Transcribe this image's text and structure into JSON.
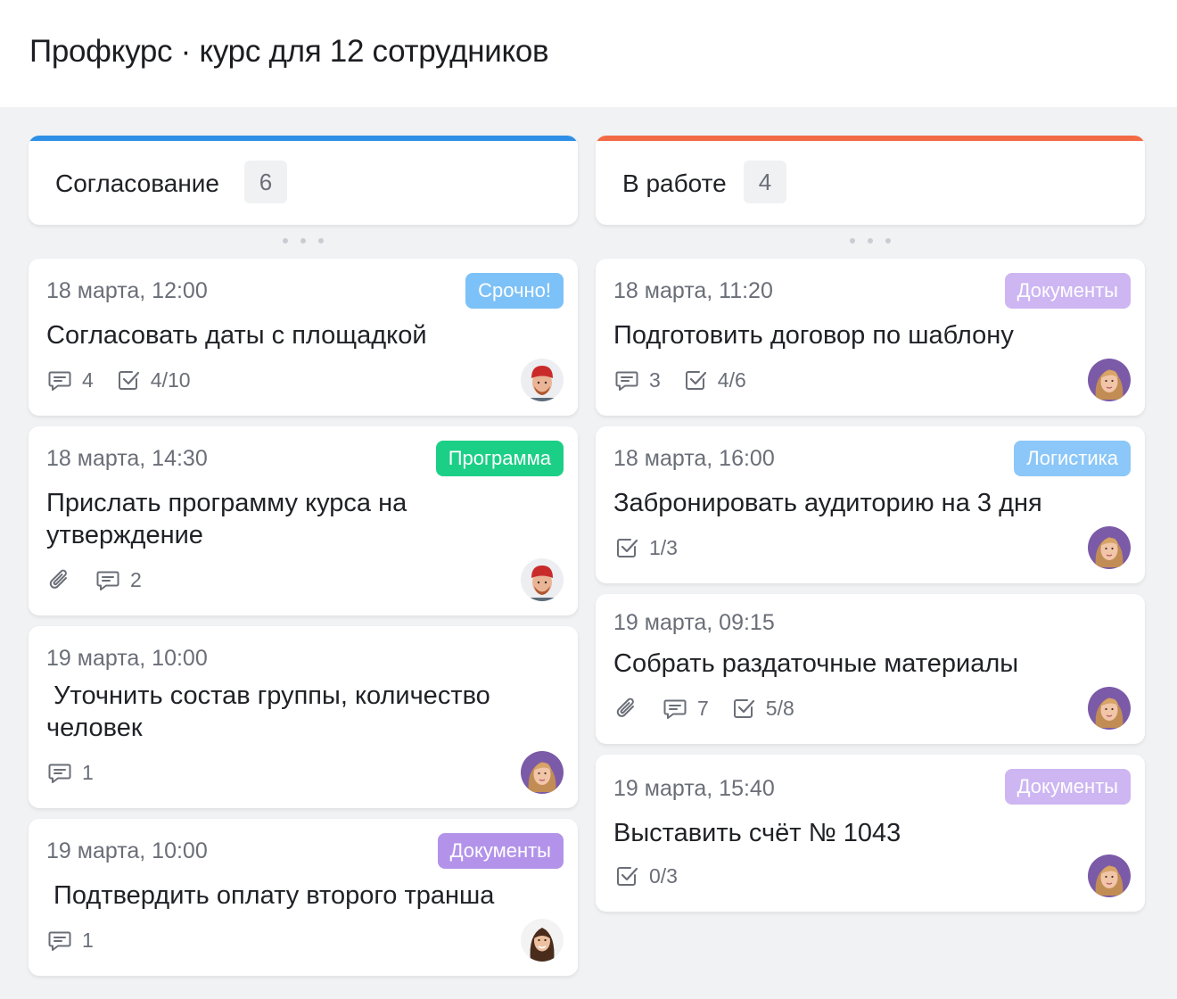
{
  "header": {
    "title": "Профкурс · курс для 12 сотрудников"
  },
  "colors": {
    "agreement_stripe": "#2e8fe6",
    "work_stripe": "#f26a45",
    "tag_urgent": "#7cc1f7",
    "tag_program": "#1ccf86",
    "tag_documents_strong": "#b393ea",
    "tag_documents_light": "#cdb6f2",
    "tag_logistics": "#8bc7f8"
  },
  "columns": [
    {
      "title": "Согласование",
      "count": "6",
      "cards": [
        {
          "date": "18 марта, 12:00",
          "tag": "Срочно!",
          "task": "Согласовать даты с площадкой",
          "comments": "4",
          "checklist": "4/10",
          "avatar": "man-red-hat"
        },
        {
          "date": "18 марта, 14:30",
          "tag": "Программа",
          "task": "Прислать программу курса на утверждение",
          "comments": "2",
          "has_attachment": true,
          "avatar": "man-red-hat"
        },
        {
          "date": "19 марта, 10:00",
          "task": " Уточнить состав группы, количество человек",
          "comments": "1",
          "avatar": "woman-blonde"
        },
        {
          "date": "19 марта, 10:00",
          "tag": "Документы",
          "task": " Подтвердить оплату второго транша",
          "comments": "1",
          "avatar": "woman-brunette"
        }
      ]
    },
    {
      "title": "В работе",
      "count": "4",
      "cards": [
        {
          "date": "18 марта, 11:20",
          "tag": "Документы",
          "task": "Подготовить договор по шаблону",
          "comments": "3",
          "checklist": "4/6",
          "avatar": "woman-blonde"
        },
        {
          "date": "18 марта, 16:00",
          "tag": "Логистика",
          "task": "Забронировать аудиторию на 3 дня",
          "checklist": "1/3",
          "avatar": "woman-blonde"
        },
        {
          "date": "19 марта, 09:15",
          "task": "Собрать раздаточные материалы",
          "comments": "7",
          "checklist": "5/8",
          "has_attachment": true,
          "avatar": "woman-blonde"
        },
        {
          "date": "19 марта, 15:40",
          "tag": "Документы",
          "task": "Выставить счёт № 1043",
          "checklist": "0/3",
          "avatar": "woman-blonde"
        }
      ]
    }
  ]
}
